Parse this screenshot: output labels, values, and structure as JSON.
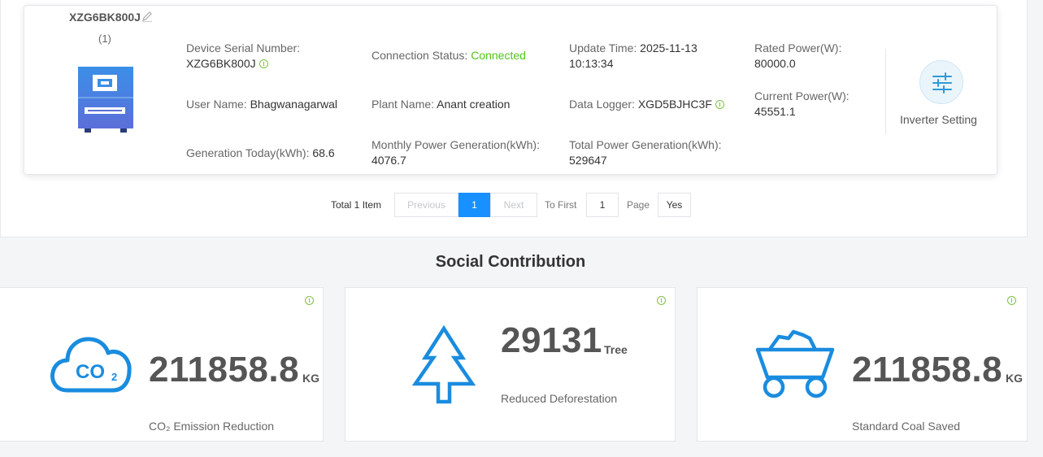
{
  "device": {
    "title": "XZG6BK800J",
    "count": "(1)",
    "serial_label": "Device Serial Number:",
    "serial_value": "XZG6BK800J",
    "connection_label": "Connection Status:",
    "connection_value": "Connected",
    "update_label": "Update Time:",
    "update_date": "2025-11-13",
    "update_time": "10:13:34",
    "rated_label": "Rated Power(W):",
    "rated_value": "80000.0",
    "user_label": "User Name:",
    "user_value": "Bhagwanagarwal",
    "plant_label": "Plant Name:",
    "plant_value": "Anant creation",
    "logger_label": "Data Logger:",
    "logger_value": "XGD5BJHC3F",
    "current_label": "Current Power(W):",
    "current_value": "45551.1",
    "today_label": "Generation Today(kWh):",
    "today_value": "68.6",
    "monthly_label": "Monthly Power Generation(kWh):",
    "monthly_value": "4076.7",
    "total_label": "Total Power Generation(kWh):",
    "total_value": "529647",
    "setting_label": "Inverter Setting"
  },
  "pagination": {
    "total": "Total 1 Item",
    "previous": "Previous",
    "current_page": "1",
    "next": "Next",
    "to_first": "To First",
    "page_input": "1",
    "page_label": "Page",
    "go": "Yes"
  },
  "social": {
    "title": "Social Contribution",
    "co2": {
      "value": "211858.8",
      "unit": "KG",
      "label": "CO₂ Emission Reduction",
      "icon": "co2-cloud-icon"
    },
    "tree": {
      "value": "29131",
      "unit": "Tree",
      "label": "Reduced Deforestation",
      "icon": "tree-icon"
    },
    "coal": {
      "value": "211858.8",
      "unit": "KG",
      "label": "Standard Coal Saved",
      "icon": "coal-cart-icon"
    }
  },
  "colors": {
    "accent": "#1890ff",
    "connected": "#52c41a",
    "icon_blue": "#1a8cdf",
    "info_green": "#7cc242"
  }
}
